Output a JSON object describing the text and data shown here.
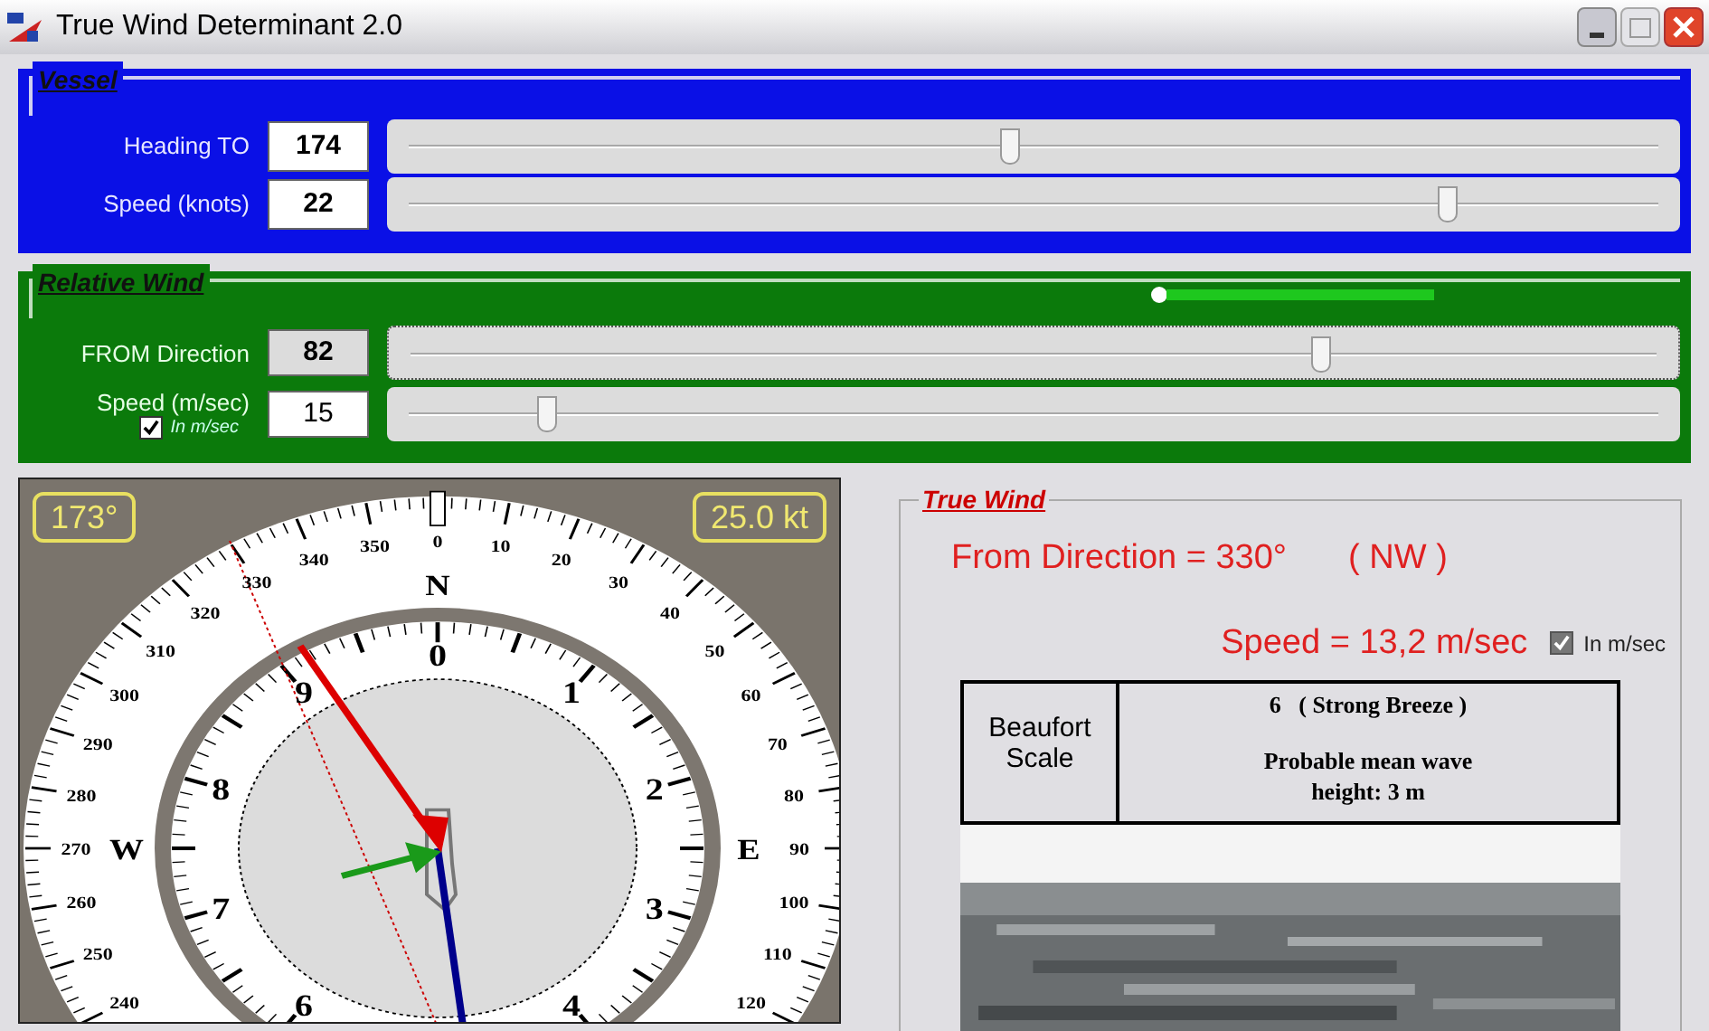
{
  "window": {
    "title": "True Wind Determinant 2.0"
  },
  "vessel": {
    "title": "Vessel",
    "rows": [
      {
        "label": "Heading TO",
        "value": "174",
        "level": 0.48
      },
      {
        "label": "Speed (knots)",
        "value": "22",
        "level": 0.83
      }
    ]
  },
  "relative_wind": {
    "title": "Relative Wind",
    "rows": [
      {
        "label": "FROM Direction",
        "value": "82",
        "level": 0.73
      },
      {
        "label": "Speed (m/sec)",
        "value": "15",
        "level": 0.11,
        "unit_checkbox": {
          "label": "In m/sec",
          "checked": true
        }
      }
    ]
  },
  "compass": {
    "heading_readout": "173°",
    "speed_readout": "25.0 kt",
    "cardinals": {
      "north": "N",
      "west": "W",
      "east": "E"
    },
    "dial_labels_east": [
      "0",
      "10",
      "20",
      "30",
      "40",
      "50",
      "60",
      "70",
      "80",
      "90",
      "100",
      "110",
      "120"
    ],
    "dial_labels_west": [
      "350",
      "340",
      "330",
      "320",
      "310",
      "300",
      "290",
      "280",
      "270",
      "260",
      "250",
      "240"
    ],
    "inner_labels_east": [
      "0",
      "1",
      "2",
      "3",
      "4"
    ],
    "inner_labels_west": [
      "9",
      "8",
      "7",
      "6"
    ]
  },
  "true_wind": {
    "title": "True Wind",
    "direction": "From Direction = 330°",
    "compass_point": "( NW )",
    "speed": "Speed = 13,2 m/sec",
    "unit_checkbox": {
      "label": "In m/sec",
      "checked": true
    },
    "beaufort": {
      "label": "Beaufort Scale",
      "force": "6   ( Strong Breeze )",
      "description": "Probable mean wave height: 3 m"
    }
  }
}
